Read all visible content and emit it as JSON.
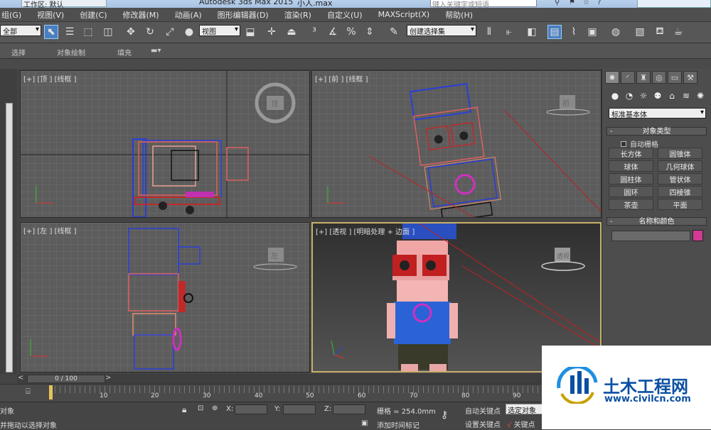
{
  "titlebar": {
    "workspace": "工作区: 默认",
    "app_title": "Autodesk 3ds Max  2015",
    "file_name": "小人.max",
    "search_placeholder": "键入关键字或短语"
  },
  "menu": [
    "组(G)",
    "视图(V)",
    "创建(C)",
    "修改器(M)",
    "动画(A)",
    "图形编辑器(D)",
    "渲染(R)",
    "自定义(U)",
    "MAXScript(X)",
    "帮助(H)"
  ],
  "toolbar": {
    "filter_value": "全部",
    "refcoord_value": "视图",
    "selection_set_value": "创建选择集"
  },
  "ribbon": {
    "tabs": [
      "选择",
      "对象绘制",
      "填充"
    ]
  },
  "viewports": {
    "top": "[+] [顶 ] [线框 ]",
    "front": "[+] [前 ] [线框 ]",
    "left": "[+] [左 ] [线框 ]",
    "persp": "[+] [透视 ] [明暗处理 + 边面 ]"
  },
  "viewcube": {
    "top": "顶",
    "front": "前",
    "left": "左",
    "persp": "透视"
  },
  "command_panel": {
    "category": "标准基本体",
    "object_type_title": "对象类型",
    "autogrid_label": "自动栅格",
    "objects": [
      "长方体",
      "圆锥体",
      "球体",
      "几何球体",
      "圆柱体",
      "管状体",
      "圆环",
      "四棱锥",
      "茶壶",
      "平面"
    ],
    "name_color_title": "名称和颜色",
    "object_color": "#d03a93"
  },
  "timeline": {
    "frame_display": "0 / 100",
    "ticks": [
      "10",
      "20",
      "30",
      "40",
      "50",
      "60",
      "70",
      "80",
      "90"
    ]
  },
  "status": {
    "selection_info": "对象",
    "prompt": "并拖动以选择对象",
    "x_label": "X:",
    "y_label": "Y:",
    "z_label": "Z:",
    "grid_info": "栅格 = 254.0mm",
    "add_time_tag": "添加时间标记",
    "auto_key": "自动关键点",
    "set_key": "设置关键点",
    "key_filter_value": "选定对象",
    "key_filters": "关键点"
  },
  "watermark": {
    "brand": "土木工程网",
    "url": "www.civilcn.com"
  }
}
